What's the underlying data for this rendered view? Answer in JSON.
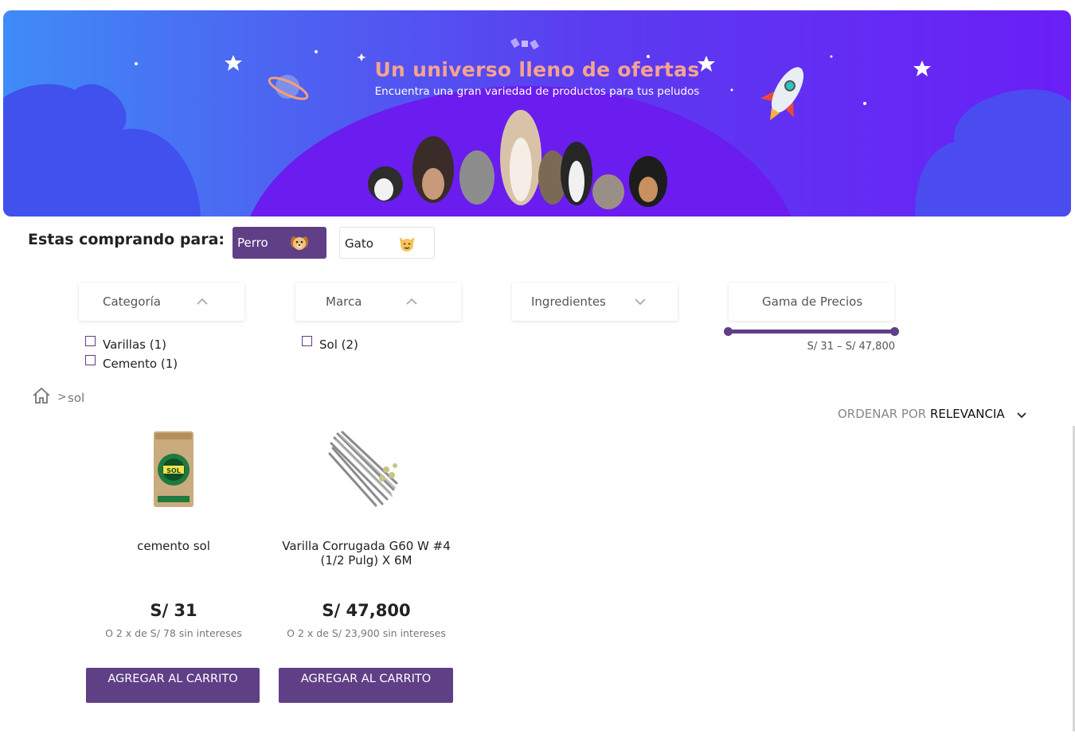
{
  "banner": {
    "title": "Un universo lleno de ofertas",
    "subtitle": "Encuentra una gran variedad de productos para tus peludos"
  },
  "pet_selector": {
    "label": "Estas comprando para:",
    "options": [
      {
        "label": "Perro",
        "icon": "dog-face-icon",
        "selected": true
      },
      {
        "label": "Gato",
        "icon": "cat-face-icon",
        "selected": false
      }
    ]
  },
  "filters": {
    "categoria": {
      "label": "Categoría",
      "options": [
        "Varillas (1)",
        "Cemento (1)"
      ]
    },
    "marca": {
      "label": "Marca",
      "options": [
        "Sol (2)"
      ]
    },
    "ingredientes": {
      "label": "Ingredientes"
    },
    "gama_precios": {
      "label": "Gama de Precios",
      "range_text": "S/ 31 – S/ 47,800",
      "min": 31,
      "max": 47800
    }
  },
  "breadcrumb": {
    "separator": ">",
    "current": "sol"
  },
  "sort": {
    "label": "ORDENAR POR",
    "value": "RELEVANCIA"
  },
  "products": [
    {
      "name": "cemento sol",
      "price": "S/ 31",
      "installments": "O 2 x de S/ 78 sin intereses",
      "button": "AGREGAR AL CARRITO"
    },
    {
      "name": "Varilla Corrugada G60 W #4 (1/2 Pulg) X 6M",
      "price": "S/ 47,800",
      "installments": "O 2 x de S/ 23,900 sin intereses",
      "button": "AGREGAR AL CARRITO"
    }
  ],
  "colors": {
    "primary": "#5f3f86",
    "banner_start": "#3f8cf7",
    "banner_end": "#6a1ff6",
    "title_accent": "#f6a38f"
  }
}
